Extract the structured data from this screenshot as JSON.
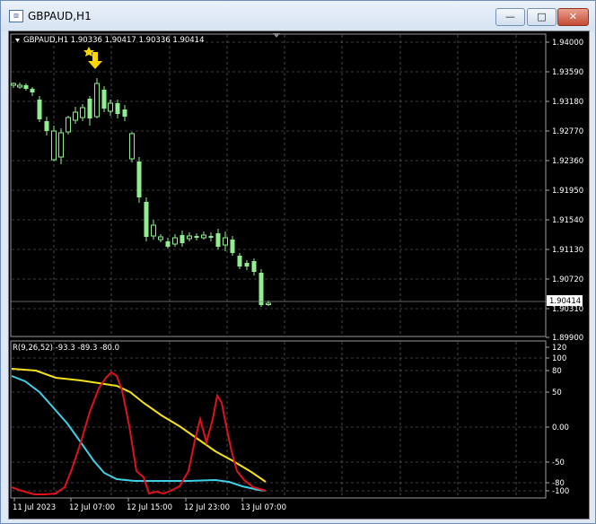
{
  "window": {
    "title": "GBPAUD,H1",
    "icon_name": "chart-window-icon",
    "minimize_label": "—",
    "maximize_label": "□",
    "close_label": "✕"
  },
  "main_chart": {
    "header_text": "GBPAUD,H1  1.90336 1.90417 1.90336 1.90414",
    "price_labels": [
      "1.94000",
      "1.93590",
      "1.93180",
      "1.92770",
      "1.92360",
      "1.91950",
      "1.91540",
      "1.91130",
      "1.90720",
      "1.90310",
      "1.89900"
    ],
    "current_price": "1.90414",
    "colors": {
      "background": "#000000",
      "candle": "#90ee90",
      "grid": "#7a7a7a",
      "arrow": "#ffd700"
    }
  },
  "indicator": {
    "header_text": "R(9,26,52) -93.3 -89.3 -80.0",
    "scale_labels": [
      "120",
      "100",
      "80",
      "50",
      "0.00",
      "-50",
      "-80",
      "-100"
    ],
    "colors": {
      "red": "#e0111d",
      "yellow": "#f5e11a",
      "cyan": "#3fd0e8"
    }
  },
  "time_axis": [
    "11 Jul 2023",
    "12 Jul 07:00",
    "12 Jul 15:00",
    "12 Jul 23:00",
    "13 Jul 07:00"
  ]
}
